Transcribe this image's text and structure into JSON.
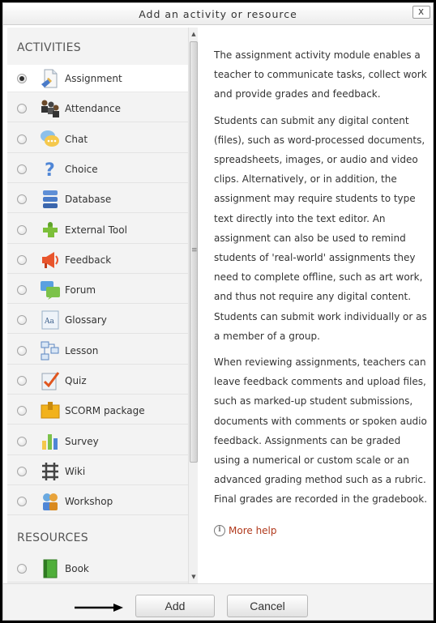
{
  "dialog": {
    "title": "Add an activity or resource",
    "close_label": "x"
  },
  "activities_heading": "ACTIVITIES",
  "resources_heading": "RESOURCES",
  "activities": [
    {
      "label": "Assignment",
      "selected": true,
      "icon": "assignment-icon"
    },
    {
      "label": "Attendance",
      "selected": false,
      "icon": "attendance-icon"
    },
    {
      "label": "Chat",
      "selected": false,
      "icon": "chat-icon"
    },
    {
      "label": "Choice",
      "selected": false,
      "icon": "choice-icon"
    },
    {
      "label": "Database",
      "selected": false,
      "icon": "database-icon"
    },
    {
      "label": "External Tool",
      "selected": false,
      "icon": "external-tool-icon"
    },
    {
      "label": "Feedback",
      "selected": false,
      "icon": "feedback-icon"
    },
    {
      "label": "Forum",
      "selected": false,
      "icon": "forum-icon"
    },
    {
      "label": "Glossary",
      "selected": false,
      "icon": "glossary-icon"
    },
    {
      "label": "Lesson",
      "selected": false,
      "icon": "lesson-icon"
    },
    {
      "label": "Quiz",
      "selected": false,
      "icon": "quiz-icon"
    },
    {
      "label": "SCORM package",
      "selected": false,
      "icon": "scorm-icon"
    },
    {
      "label": "Survey",
      "selected": false,
      "icon": "survey-icon"
    },
    {
      "label": "Wiki",
      "selected": false,
      "icon": "wiki-icon"
    },
    {
      "label": "Workshop",
      "selected": false,
      "icon": "workshop-icon"
    }
  ],
  "resources": [
    {
      "label": "Book",
      "selected": false,
      "icon": "book-icon"
    }
  ],
  "description": {
    "p1": "The assignment activity module enables a teacher to communicate tasks, collect work and provide grades and feedback.",
    "p2": "Students can submit any digital content (files), such as word-processed documents, spreadsheets, images, or audio and video clips. Alternatively, or in addition, the assignment may require students to type text directly into the text editor. An assignment can also be used to remind students of 'real-world' assignments they need to complete offline, such as art work, and thus not require any digital content. Students can submit work individually or as a member of a group.",
    "p3": "When reviewing assignments, teachers can leave feedback comments and upload files, such as marked-up student submissions, documents with comments or spoken audio feedback. Assignments can be graded using a numerical or custom scale or an advanced grading method such as a rubric. Final grades are recorded in the gradebook.",
    "more_help": "More help"
  },
  "footer": {
    "add_label": "Add",
    "cancel_label": "Cancel"
  },
  "colors": {
    "link": "#b1391c",
    "list_bg": "#f3f3f3"
  }
}
